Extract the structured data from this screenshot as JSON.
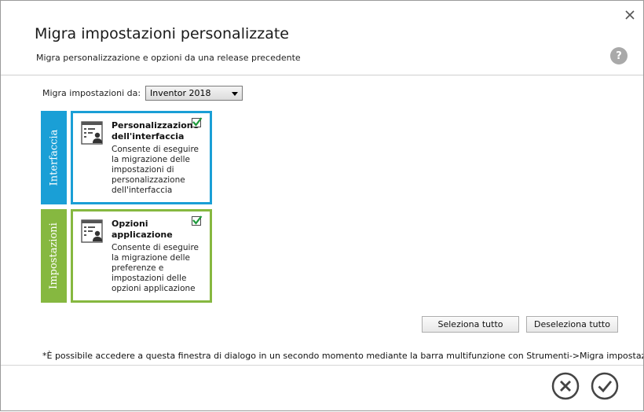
{
  "dialog": {
    "title": "Migra impostazioni personalizzate",
    "subtitle": "Migra personalizzazione e opzioni da una release precedente",
    "help_label": "?"
  },
  "migrate": {
    "label": "Migra impostazioni da:",
    "selected": "Inventor 2018"
  },
  "tabs": {
    "interface": "Interfaccia",
    "settings": "Impostazioni"
  },
  "cards": [
    {
      "title": "Personalizzazione dell'interfaccia",
      "description": "Consente di eseguire la migrazione delle impostazioni di personalizzazione dell'interfaccia",
      "checked": true
    },
    {
      "title": "Opzioni applicazione",
      "description": "Consente di eseguire la migrazione delle preferenze e impostazioni delle opzioni applicazione",
      "checked": true
    }
  ],
  "buttons": {
    "select_all": "Seleziona tutto",
    "deselect_all": "Deseleziona tutto"
  },
  "footnote": "*È possibile accedere a questa finestra di dialogo in un secondo momento mediante la barra multifunzione con Strumenti->Migra impostazioni.",
  "colors": {
    "interface_accent": "#1a9fd6",
    "settings_accent": "#86b840",
    "check_green": "#1f9a3c"
  },
  "icons": {
    "close": "close-icon",
    "help": "help-icon",
    "card": "settings-user-icon",
    "cancel": "cancel-icon",
    "ok": "ok-icon"
  }
}
